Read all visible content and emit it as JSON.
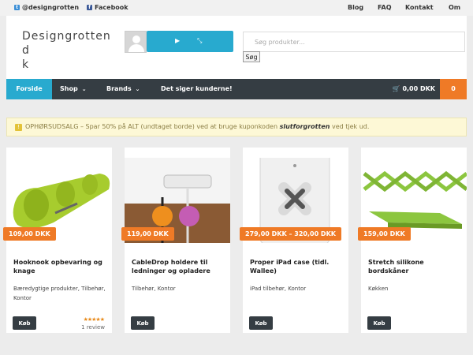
{
  "topbar": {
    "twitter": "@designgrotten",
    "facebook": "Facebook",
    "links": [
      "Blog",
      "FAQ",
      "Kontakt",
      "Om"
    ]
  },
  "header": {
    "logo": "Designgrotten d\nk",
    "search_placeholder": "Søg produkter...",
    "search_button": "Søg"
  },
  "nav": {
    "items": [
      "Forside",
      "Shop",
      "Brands",
      "Det siger kunderne!"
    ],
    "cart_total": "0,00 DKK",
    "cart_count": "0"
  },
  "notice": {
    "text_before": "OPHØRSUDSALG – Spar 50% på ALT (undtaget borde) ved at bruge kuponkoden ",
    "code": "slutforgrotten",
    "text_after": " ved tjek ud."
  },
  "products": [
    {
      "price": "109,00 DKK",
      "title": "Hooknook opbevaring og knage",
      "categories": "Bæredygtige produkter, Tilbehør, Kontor",
      "buy": "Køb",
      "rating": 5,
      "review": "1 review"
    },
    {
      "price": "119,00 DKK",
      "title": "CableDrop holdere til ledninger og opladere",
      "categories": "Tilbehør, Kontor",
      "buy": "Køb"
    },
    {
      "price": "279,00 DKK – 320,00 DKK",
      "title": "Proper iPad case (tidl. Wallee)",
      "categories": "iPad tilbehør, Kontor",
      "buy": "Køb"
    },
    {
      "price": "159,00 DKK",
      "title": "Stretch silikone bordskåner",
      "categories": "Køkken",
      "buy": "Køb"
    }
  ],
  "colors": {
    "accent_blue": "#28aacf",
    "accent_orange": "#ef7a26",
    "nav_dark": "#353d43"
  }
}
